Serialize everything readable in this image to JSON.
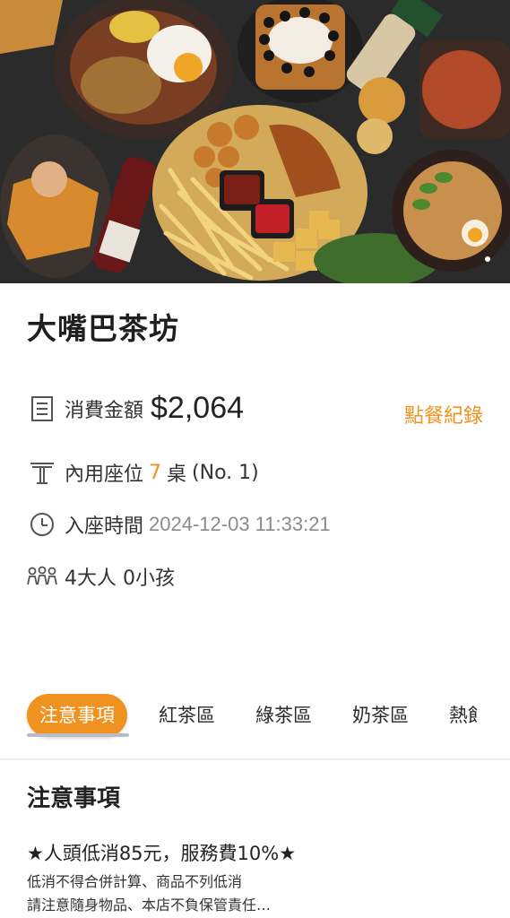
{
  "store": {
    "name": "大嘴巴茶坊"
  },
  "bill": {
    "amount_label": "消費金額",
    "amount_value": "$2,064",
    "order_history_link": "點餐紀錄"
  },
  "seat": {
    "label": "內用座位",
    "table_number": "7",
    "table_suffix": "桌",
    "seat_code": "(No. 1)"
  },
  "checkin": {
    "label": "入座時間",
    "time": "2024-12-03 11:33:21"
  },
  "guests": {
    "text": "4大人 0小孩"
  },
  "tabs": [
    {
      "label": "注意事項",
      "active": true
    },
    {
      "label": "紅茶區"
    },
    {
      "label": "綠茶區"
    },
    {
      "label": "奶茶區"
    },
    {
      "label": "熱飠"
    }
  ],
  "notice": {
    "title": "注意事項",
    "line1": "★人頭低消85元，服務費10%★",
    "line2": "低消不得合併計算、商品不列低消",
    "line3": "請注意隨身物品、本店不負保管責任…"
  },
  "colors": {
    "accent": "#f0921f"
  },
  "icons": {
    "amount": "receipt-icon",
    "seat": "table-icon",
    "time": "clock-icon",
    "people": "people-icon"
  }
}
